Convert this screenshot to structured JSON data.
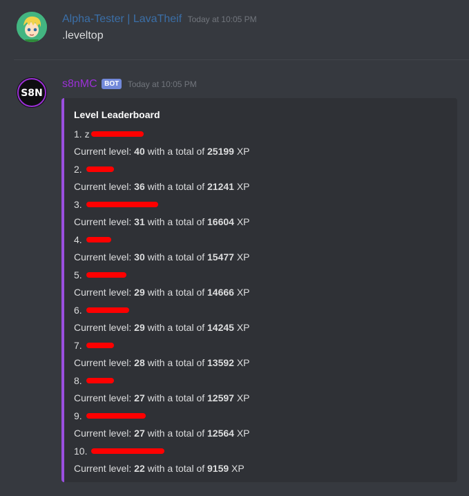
{
  "messages": [
    {
      "author": "Alpha-Tester | LavaTheif",
      "author_color": "#3b6fa8",
      "timestamp": "Today at 10:05 PM",
      "content": ".leveltop"
    },
    {
      "author": "s8nMC",
      "author_color": "#9b30d6",
      "badge": "BOT",
      "timestamp": "Today at 10:05 PM"
    }
  ],
  "embed": {
    "accent_color": "#9b4fe0",
    "title": "Level Leaderboard",
    "level_prefix": "Current level: ",
    "total_text": " with a total of ",
    "xp_suffix": " XP",
    "entries": [
      {
        "rank": "1.",
        "name_visible": "z",
        "name_redacted": true,
        "level": "40",
        "xp": "25199"
      },
      {
        "rank": "2.",
        "name_visible": "",
        "name_redacted": true,
        "level": "36",
        "xp": "21241"
      },
      {
        "rank": "3.",
        "name_visible": "",
        "name_redacted": true,
        "level": "31",
        "xp": "16604"
      },
      {
        "rank": "4.",
        "name_visible": "",
        "name_redacted": true,
        "level": "30",
        "xp": "15477"
      },
      {
        "rank": "5.",
        "name_visible": "",
        "name_redacted": true,
        "level": "29",
        "xp": "14666"
      },
      {
        "rank": "6.",
        "name_visible": "",
        "name_redacted": true,
        "level": "29",
        "xp": "14245"
      },
      {
        "rank": "7.",
        "name_visible": "",
        "name_redacted": true,
        "level": "28",
        "xp": "13592"
      },
      {
        "rank": "8.",
        "name_visible": "",
        "name_redacted": true,
        "level": "27",
        "xp": "12597"
      },
      {
        "rank": "9.",
        "name_visible": "",
        "name_redacted": true,
        "level": "27",
        "xp": "12564"
      },
      {
        "rank": "10.",
        "name_visible": "",
        "name_redacted": true,
        "level": "22",
        "xp": "9159"
      }
    ]
  },
  "icons": {
    "user_avatar": "cartoon-avatar-icon",
    "bot_avatar": "s8n-logo-icon"
  }
}
